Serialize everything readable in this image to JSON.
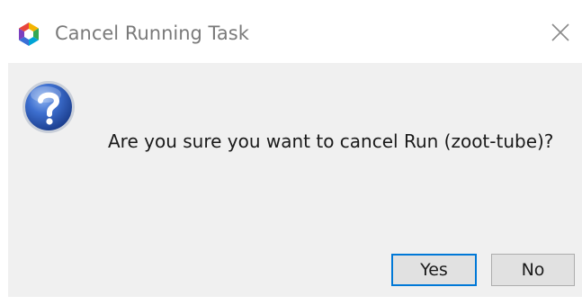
{
  "window": {
    "title": "Cancel Running Task",
    "app_icon": "app-hexagon-icon",
    "close_icon": "close-icon"
  },
  "dialog": {
    "icon": "question-icon",
    "message": "Are you sure you want to cancel Run (zoot-tube)?"
  },
  "buttons": {
    "yes_label": "Yes",
    "no_label": "No",
    "default": "Yes"
  },
  "colors": {
    "focus_border": "#0078d7",
    "body_background": "#f0f0f0",
    "button_background": "#e1e1e1"
  }
}
